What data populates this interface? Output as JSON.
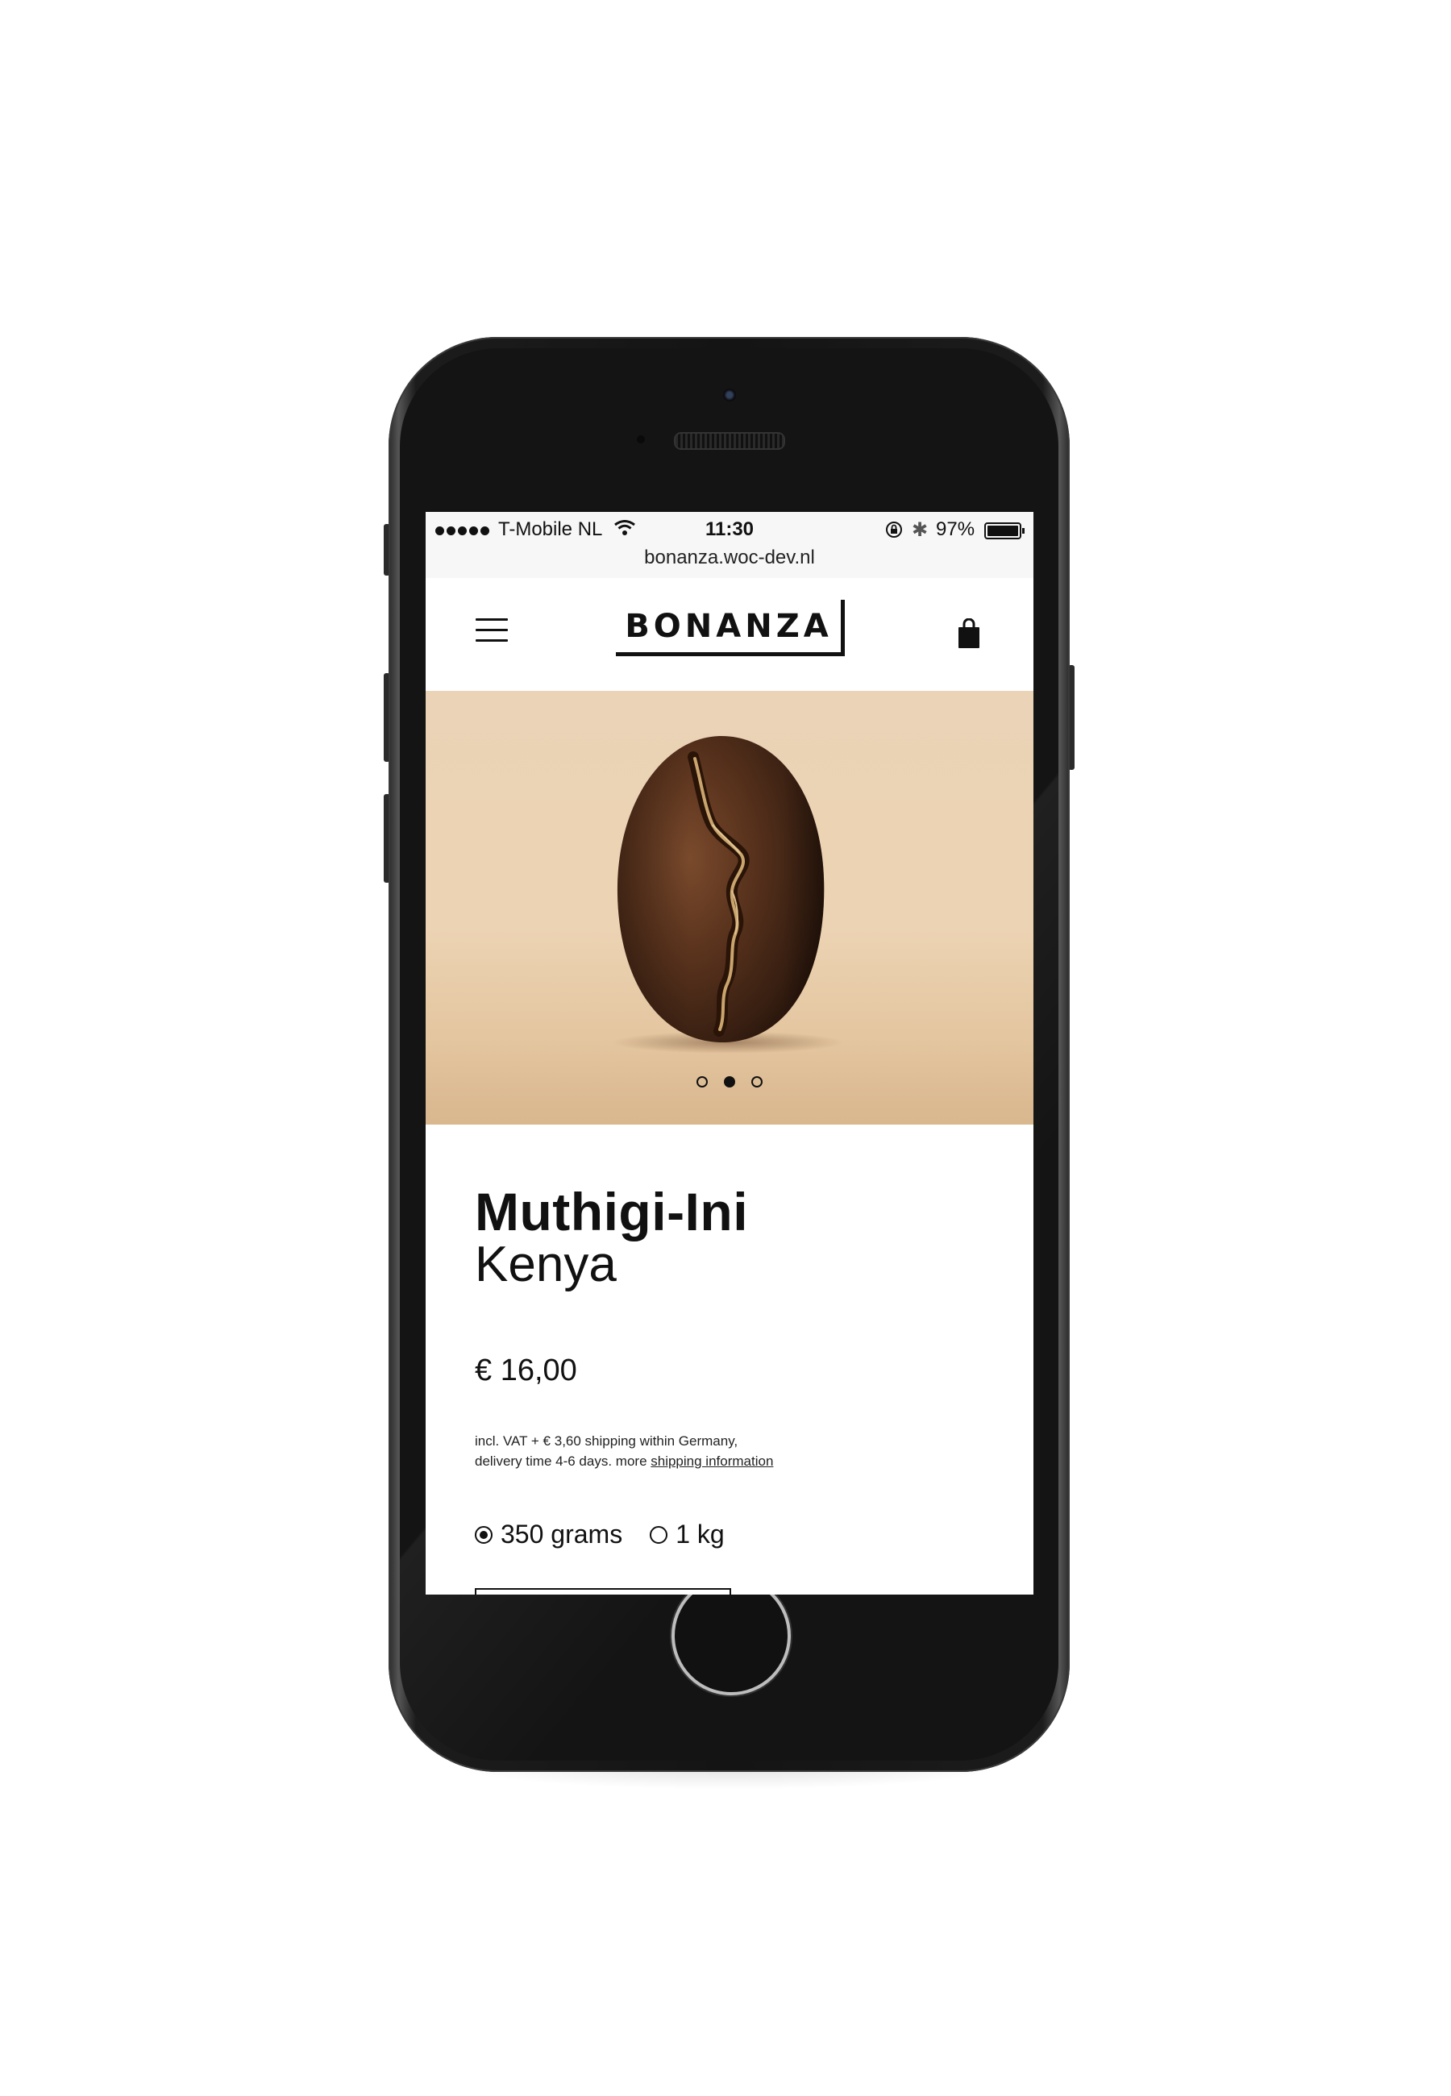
{
  "status_bar": {
    "carrier": "T-Mobile NL",
    "time": "11:30",
    "battery": "97%",
    "url": "bonanza.woc-dev.nl"
  },
  "header": {
    "logo": "BONANZA",
    "menu_icon": "hamburger-menu-icon",
    "cart_icon": "shopping-bag-icon"
  },
  "hero": {
    "image": "coffee-bean-photo",
    "slide_count": 3,
    "active_slide": 2,
    "background": "#ebd2b1"
  },
  "product": {
    "name": "Muthigi-Ini",
    "origin": "Kenya",
    "price": "€ 16,00",
    "shipping_text": "incl. VAT + € 3,60 shipping within Germany, delivery time 4-6 days. more ",
    "shipping_link": "shipping information",
    "options": [
      {
        "label": "350 grams",
        "selected": true
      },
      {
        "label": "1 kg",
        "selected": false
      }
    ]
  }
}
